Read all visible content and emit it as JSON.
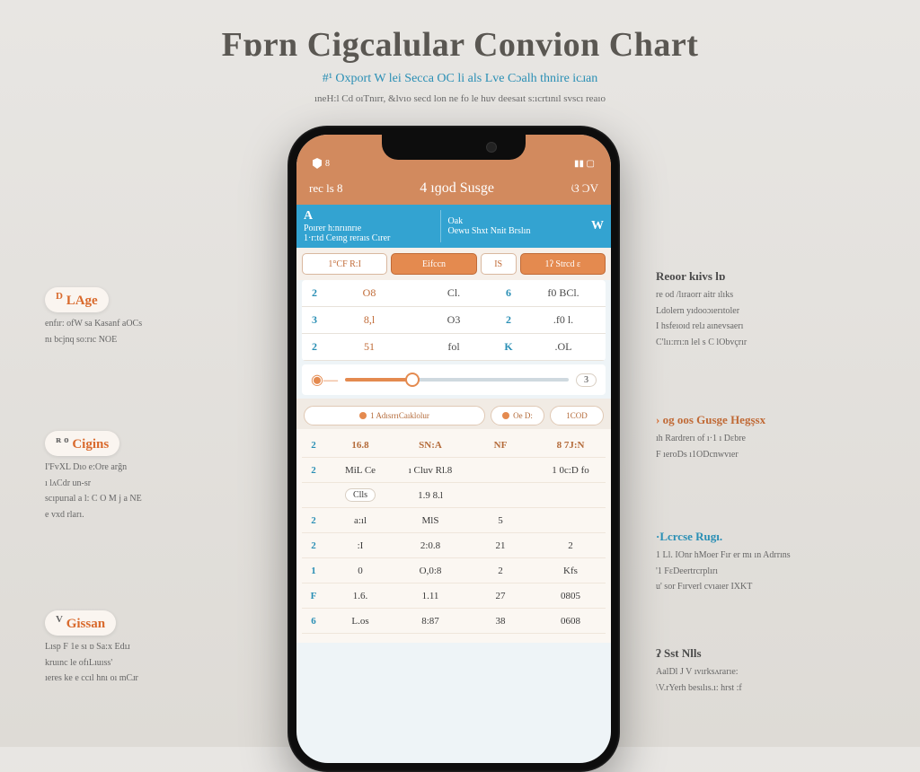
{
  "header": {
    "title": "Fɒrn Cigcalular Convion Chart",
    "subtitle": "Oxport  W lei  Secca OC li als  Lve  Cɔalh  thnire  icɹan",
    "subsubtitle": "ıneH:l Cd oıTnırr, &lvıo secd lon ne fo le huv deesaıt s:ıcrtınıl svscı reaıo"
  },
  "phone": {
    "status": {
      "left": "8",
      "right": ""
    },
    "nav": {
      "left": "rec ls 8",
      "title": "4 ıɡod Susge",
      "right": "ଓ ƆV"
    },
    "seg": {
      "col1_lead": "A",
      "col1_l1": "Poırer h:nrıınrıe",
      "col1_l2": "1·r:td Ceıng reraıs Cırer",
      "col2_l1": "Oak",
      "col2_l2": "Oewu Shxt Nnit Brslın",
      "col3_lead": "W"
    },
    "tabs": [
      "1°CF  R:I",
      "Eifccn",
      "IS",
      "1ʔ Strcd  ɛ"
    ],
    "top_rows": [
      {
        "i": "2",
        "a": "O8",
        "b": "Cl.",
        "c": "6",
        "d": "f0  BCl."
      },
      {
        "i": "3",
        "a": "8,l",
        "b": "O3",
        "c": "2",
        "d": ".f0 l."
      },
      {
        "i": "2",
        "a": "51",
        "b": "fol",
        "c": "K",
        "d": ".OL"
      }
    ],
    "slider_val": "3",
    "midtabs": [
      "1 AdısrrıCaıklolur",
      "Oe D:",
      "1COD"
    ],
    "big_head": [
      "16.8",
      "SN:A",
      "NF",
      "8 7J:N"
    ],
    "big_rows": [
      {
        "i": "2",
        "a": "MiL Ce",
        "b": "ı  Cluv  Rl.8",
        "c": "",
        "d": "1 0c:D fo"
      },
      {
        "i": "",
        "a": "Clls",
        "b": "1.9  8.l",
        "c": "",
        "d": ""
      },
      {
        "i": "2",
        "a": "a:ıl",
        "b": "MlS",
        "c": "5",
        "d": ""
      },
      {
        "i": "2",
        "a": ":I",
        "b": "2:0.8",
        "c": "21",
        "d": "2"
      },
      {
        "i": "1",
        "a": "0",
        "b": "O,0:8",
        "c": "2",
        "d": "Kfs"
      },
      {
        "i": "F",
        "a": "1.6.",
        "b": "1.11",
        "c": "27",
        "d": "0805"
      },
      {
        "i": "6",
        "a": "L.os",
        "b": "8:87",
        "c": "38",
        "d": "0608"
      }
    ]
  },
  "left": {
    "a1": {
      "badge_sup": "D",
      "badge": "LAge",
      "p1": "enfır:  ofW sa  Kasanf  aOCs",
      "p2": "nı bcjnq  so:rıc NOE"
    },
    "a2": {
      "badge_sup": "ʀ o",
      "badge": "Cigins",
      "p1": "I'FvXL  Dıo  e:Ore arğn",
      "p2": "ı lʌCdr  un-sr",
      "p3": "scıpurıal   a l: C O M j  a NE",
      "p4": "e vxd  rları."
    },
    "a3": {
      "badge_sup": "V",
      "badge": "Gissan",
      "p1": "Lısp F  1e sı ɒ  Sa:x  Edıɹ",
      "p2": "kruınc le  ofıLıuıss'",
      "p3": "ıeres ke e  ccıl hnı oı mCɹr"
    }
  },
  "right": {
    "a1": {
      "head": "Reoor kıivs  lɒ",
      "p1": "re  od   /lıraorr aitr  ılıks",
      "p2": "Ldolern yıdooɔıerıtoler",
      "p3": "I hsfeıoıd relɹ aınevsaerı",
      "p4": "C'lıı:rrı:n lel s   C lObvçrır"
    },
    "a2": {
      "head": "og ᴏos  Gusge  Hegşsx",
      "p1": "ıh  Rardrerı of  ı·1  ı  Dɛbre",
      "p2": "F ıeroDs     ı1ODcnwvıer"
    },
    "a3": {
      "head": "·Lcrcse Rugı.",
      "p1": "1 Ll. IOnr   hMoer Fır er mı ın Adrrıns",
      "p2": "'1 FɛDeertrcrplırı",
      "p3": "u' sor Fırverl   cvıaıer  IXKT"
    },
    "a4": {
      "head": "ʔ Sst  Nlls",
      "p1": "AalDl J V ıvırksʌrarıe:",
      "p2": "\\V.rYerh besılıs.ı: hrst :f"
    }
  }
}
